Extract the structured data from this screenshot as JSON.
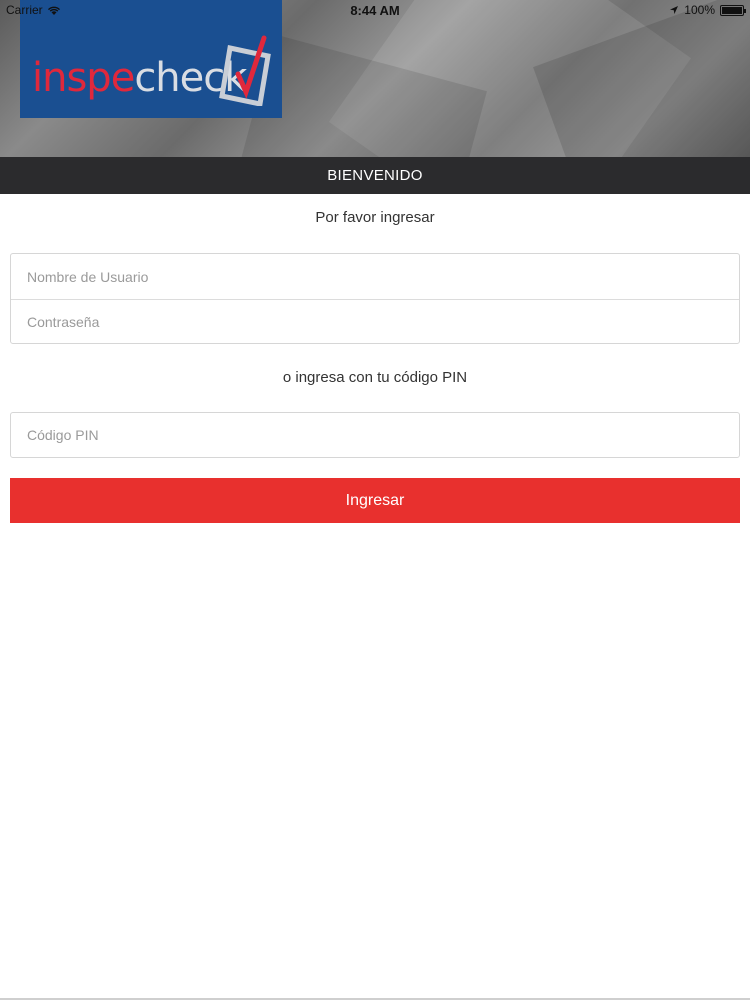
{
  "status_bar": {
    "carrier": "Carrier",
    "time": "8:44 AM",
    "battery": "100%",
    "battery_level": 1.0,
    "icons": [
      "wifi-icon",
      "location-arrow-icon",
      "battery-icon"
    ]
  },
  "brand": {
    "logo_part1": "inspe",
    "logo_part2": "check",
    "colors": {
      "logo_bg": "#1a4f91",
      "logo_red": "#e0283c",
      "logo_silver": "#d9dde3"
    }
  },
  "header": {
    "title": "BIENVENIDO"
  },
  "login": {
    "prompt": "Por favor ingresar",
    "username_placeholder": "Nombre de Usuario",
    "username_value": "",
    "password_placeholder": "Contraseña",
    "password_value": "",
    "alt_prompt": "o ingresa con tu código PIN",
    "pin_placeholder": "Código PIN",
    "pin_value": "",
    "submit_label": "Ingresar"
  },
  "colors": {
    "accent": "#e8302e",
    "title_bar": "#2b2b2d"
  }
}
